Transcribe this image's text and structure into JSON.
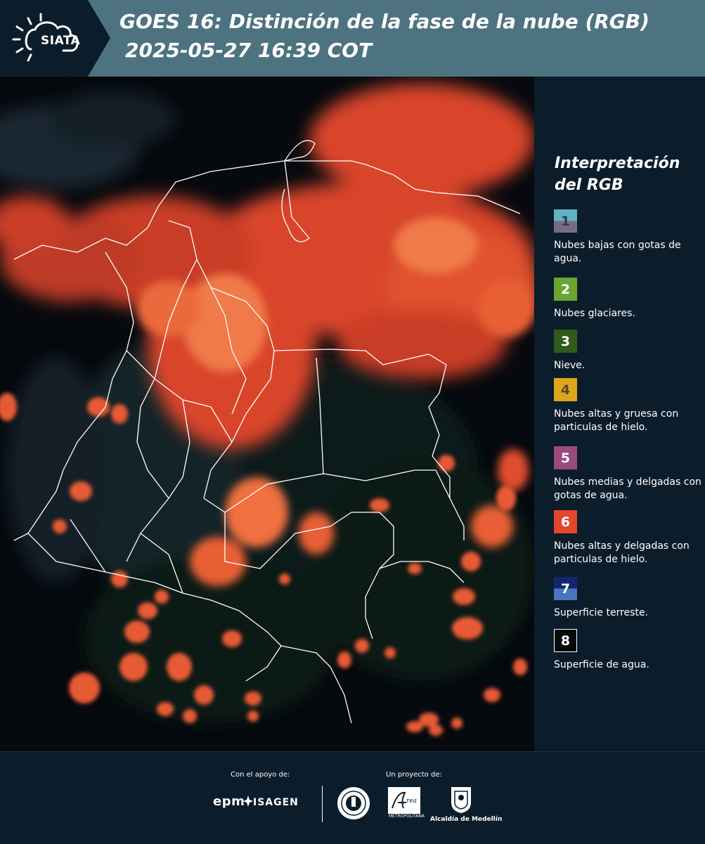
{
  "header": {
    "logo_text": "SIATA",
    "title_line1": "GOES 16: Distinción de la fase de la nube (RGB)",
    "title_line2": "2025-05-27 16:39 COT",
    "colors": {
      "dark": "#0b1d2b",
      "band": "#4e7380"
    }
  },
  "map": {
    "image_type": "satellite-rgb-cloud-phase",
    "overlay": "country and department borders (white)"
  },
  "legend": {
    "title": "Interpretación del RGB",
    "items": [
      {
        "number": "1",
        "label": "Nubes bajas con gotas de agua.",
        "color_top": "#5fb3c1",
        "color_bottom": "#7b6a86"
      },
      {
        "number": "2",
        "label": "Nubes glaciares.",
        "color_top": "#6aa632",
        "color_bottom": "#6aa632"
      },
      {
        "number": "3",
        "label": "Nieve.",
        "color_top": "#2f5a19",
        "color_bottom": "#2f5a19"
      },
      {
        "number": "4",
        "label": "Nubes altas y gruesa con particulas de hielo.",
        "color_top": "#dba61b",
        "color_bottom": "#dba61b"
      },
      {
        "number": "5",
        "label": "Nubes medias y delgadas con gotas de agua.",
        "color_top": "#9a4a7c",
        "color_bottom": "#9a4a7c"
      },
      {
        "number": "6",
        "label": "Nubes altas y delgadas con particulas de hielo.",
        "color_top": "#e2472b",
        "color_bottom": "#e2472b"
      },
      {
        "number": "7",
        "label": "Superficie terreste.",
        "color_top": "#13266e",
        "color_bottom": "#4b74c0"
      },
      {
        "number": "8",
        "label": "Superficie de agua.",
        "color_top": "#050a06",
        "color_bottom": "#050a06"
      }
    ]
  },
  "footer": {
    "support_label": "Con el apoyo de:",
    "project_label": "Un proyecto de:",
    "sponsors": [
      "epm",
      "ISAGEN"
    ],
    "amva_text": "METROPOLITANA",
    "medellin_text": "Alcaldía de Medellín"
  }
}
